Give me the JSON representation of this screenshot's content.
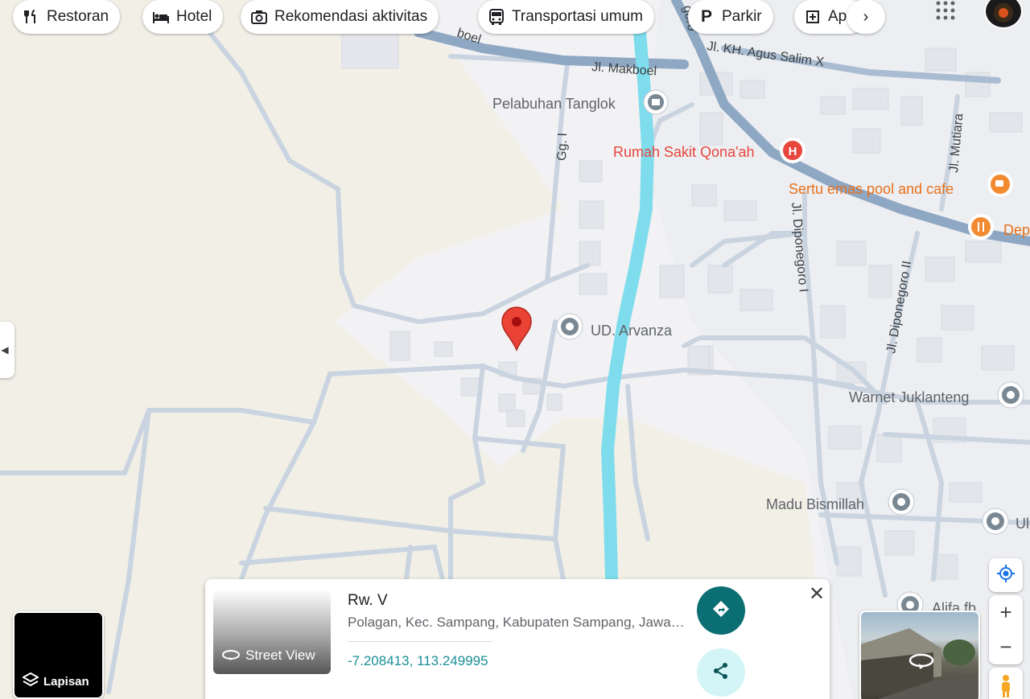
{
  "chips": [
    {
      "icon": "fork-knife-icon",
      "label": "Restoran"
    },
    {
      "icon": "bed-icon",
      "label": "Hotel"
    },
    {
      "icon": "camera-icon",
      "label": "Rekomendasi aktivitas"
    },
    {
      "icon": "bus-icon",
      "label": "Transportasi umum"
    },
    {
      "icon": "parking-icon",
      "label": "Parkir"
    },
    {
      "icon": "building-icon",
      "label": "Ap"
    }
  ],
  "map": {
    "roads": [
      "Jl. Makboel",
      "Jl. KH. Agus Salim X",
      "Gg. I",
      "Jl. Mutiara",
      "Jl. Diponegoro I",
      "Jl. Diponegoro II",
      "Jl. Diponegoro"
    ],
    "road_fragment_left": "boel",
    "road_fragment_top": "goro",
    "places": {
      "harbor": "Pelabuhan Tanglok",
      "hospital": "Rumah Sakit Qona'ah",
      "cafe": "Sertu emas pool and cafe",
      "restaurant": "Dep",
      "store": "UD. Arvanza",
      "warnet": "Warnet Juklanteng",
      "madu": "Madu Bismillah",
      "alifa": "Alifa fb",
      "ul": "Ul"
    },
    "colors": {
      "land": "#f1efe6",
      "urban": "#f3f3f5",
      "road": "#c8d3df",
      "main_road": "#8ea7c3",
      "river": "#7fdcec",
      "pin": "#ea4335"
    }
  },
  "layers": {
    "label": "Lapisan"
  },
  "card": {
    "street_view_label": "Street View",
    "title": "Rw. V",
    "address": "Polagan, Kec. Sampang, Kabupaten Sampang, Jawa Timur",
    "coordinates": "-7.208413, 113.249995"
  },
  "controls": {
    "zoom_in": "+",
    "zoom_out": "−"
  }
}
